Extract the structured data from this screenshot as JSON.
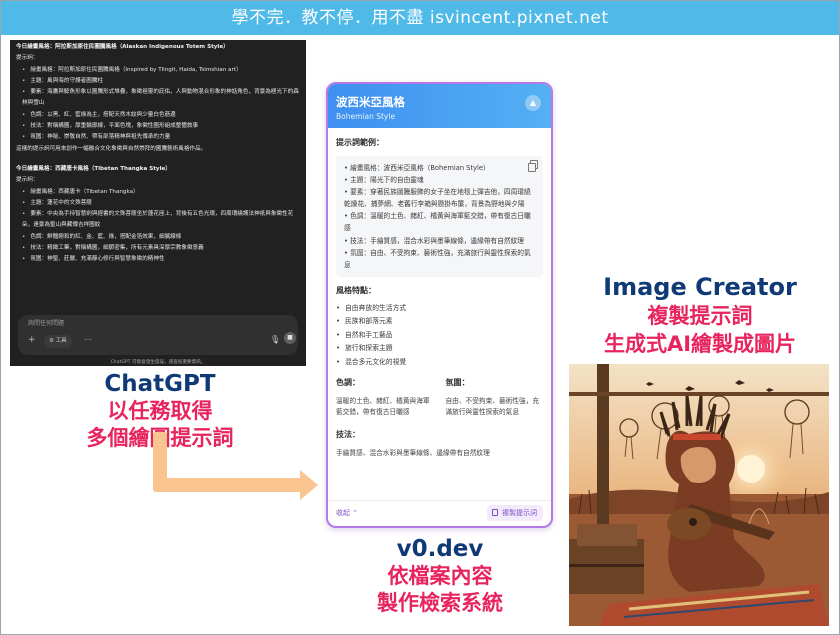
{
  "banner": {
    "text": "學不完．教不停．用不盡 isvincent.pixnet.net"
  },
  "chatgpt": {
    "s1_title": "今日繪畫風格：阿拉斯加原住民圖騰風格（Alaskan Indigenous Totem Style）",
    "s1_prompt_label": "提示詞：",
    "s1_items": [
      "繪畫風格：阿拉斯加原住民圖騰風格（Inspired by Tlingit, Haida, Tsimshian art）",
      "主題：風與海的守護者圖騰柱",
      "要素：海鷹與鯨魚形象以圖騰形式堆疊，象徵祖靈的庇佑，人與動物混合形象的神話角色，背景為極光下的森林與雪山",
      "色調：以黑、紅、藍綠為主，搭配天然木紋與少量白色筋邊",
      "技法：對稱構圖，厚重輪廓線，平面色塊，象徵性圖形組成整體敘事",
      "氛圍：神秘、崇敬自然、帶有部落精神與祖先傳承的力量"
    ],
    "s1_note": "這樣的提示詞可用來創作一幅融合文化象徵與自然崇拜的圖騰藝術風格作品。",
    "s2_title": "今日繪畫風格：西藏唐卡風格（Tibetan Thangka Style）",
    "s2_prompt_label": "提示詞：",
    "s2_items": [
      "繪畫風格：西藏唐卡（Tibetan Thangka）",
      "主題：蓮花中的文殊菩薩",
      "要素：中央為手持智慧劍與經書的文殊菩薩坐於蓮花座上，背後有五色光環，四周環繞護法神祇與象徵性花朵，遠景為聖山與藏傳吉祥圖紋",
      "色調：鮮豔飽和的紅、金、藍、綠，搭配金箔效果，細膩線條",
      "技法：精緻工筆，對稱構圖，細節密集，所有元素具深厚宗教象徵意義",
      "氛圍：神聖、莊嚴、充滿靜心修行與智慧象徵的精神性"
    ],
    "input_placeholder": "詢問任何問題",
    "plus": "+",
    "tools_label": "⚙ 工具",
    "dots": "⋯",
    "mic": "🎙",
    "send": "■",
    "footer": "ChatGPT 可能會發生錯誤，請查核重要資訊。"
  },
  "captions": {
    "chatgpt_name": "ChatGPT",
    "chatgpt_line1": "以任務取得",
    "chatgpt_line2": "多個繪圖提示詞",
    "v0_name": "v0.dev",
    "v0_line1": "依檔案內容",
    "v0_line2": "製作檢索系統",
    "ic_name": "Image Creator",
    "ic_line1": "複製提示詞",
    "ic_line2": "生成式AI繪製成圖片"
  },
  "card": {
    "title": "波西米亞風格",
    "subtitle": "Bohemian Style",
    "collapse_icon": "chevron-up",
    "prompt_example_label": "提示詞範例：",
    "prompt_lines": [
      "• 繪畫風格：波西米亞風格（Bohemian Style）",
      "• 主題：陽光下的自由靈魂",
      "• 要素：穿著民族圖騰服飾的女子坐在地毯上彈吉他，四周環繞乾燥花、捕夢網、老舊行李箱與懸掛布簾，背景為野地與夕陽",
      "• 色調：溫暖的土色、赭紅、橘黃與海軍藍交錯，帶有復古日曬感",
      "• 技法：手繪質感，混合水彩與墨筆線條，邊緣帶有自然紋理",
      "• 氛圍：自由、不受拘束、藝術性強，充滿旅行與靈性探索的氣息"
    ],
    "features_label": "風格特點：",
    "features": [
      "自由奔放的生活方式",
      "民族和部落元素",
      "自然和手工藝品",
      "旅行和探索主題",
      "混合多元文化的視覺"
    ],
    "color_label": "色調：",
    "color_text": "溫暖的土色、赭紅、橘黃與海軍藍交錯，帶有復古日曬感",
    "mood_label": "氛圍：",
    "mood_text": "自由、不受拘束、藝術性強，充滿旅行與靈性探索的氣息",
    "tech_label": "技法：",
    "tech_text": "手繪質感、混合水彩與墨筆線條、邊緣帶有自然紋理",
    "collapse_link": "收起 ⌃",
    "copy_button": "複製提示詞"
  },
  "colors": {
    "banner": "#4fb9e8",
    "caption_name": "#103a75",
    "caption_sub": "#e8245e",
    "card_border": "#b57ae8",
    "arrow": "#f9c48f"
  }
}
